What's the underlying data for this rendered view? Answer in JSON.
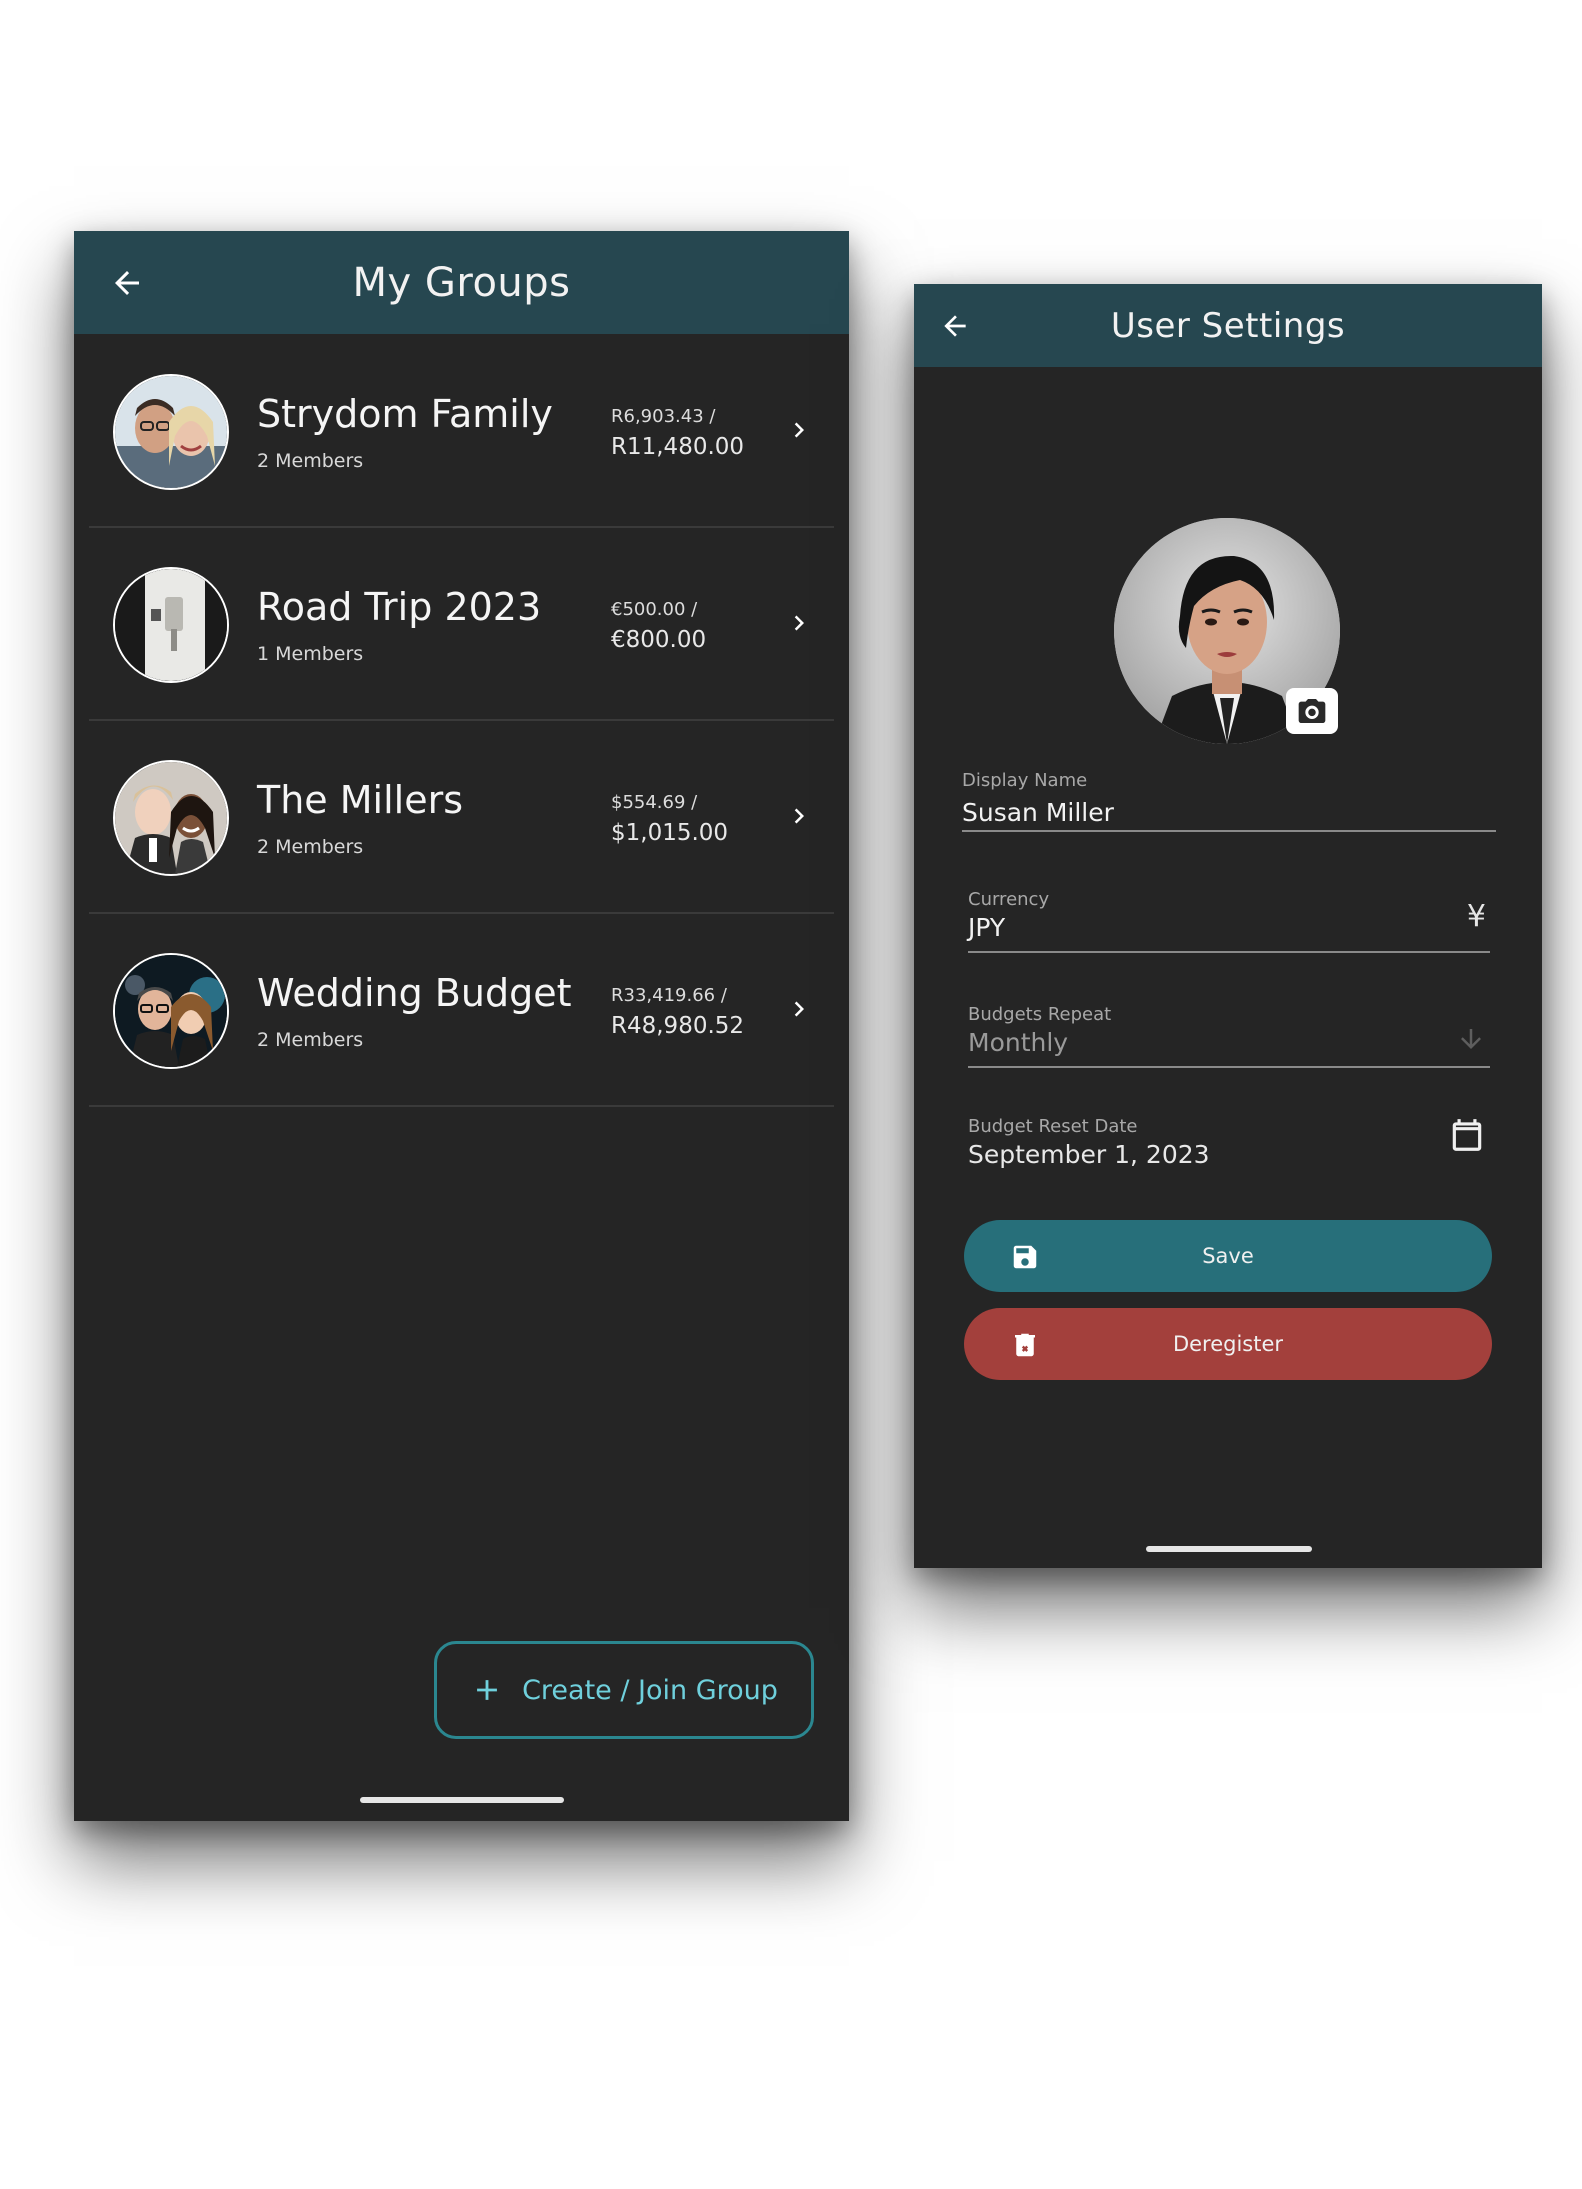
{
  "groups_screen": {
    "title": "My Groups",
    "groups": [
      {
        "name": "Strydom Family",
        "members": "2 Members",
        "spent": "R6,903.43 /",
        "budget": "R11,480.00"
      },
      {
        "name": "Road Trip 2023",
        "members": "1 Members",
        "spent": "€500.00 /",
        "budget": "€800.00"
      },
      {
        "name": "The Millers",
        "members": "2 Members",
        "spent": "$554.69 /",
        "budget": "$1,015.00"
      },
      {
        "name": "Wedding Budget",
        "members": "2 Members",
        "spent": "R33,419.66 /",
        "budget": "R48,980.52"
      }
    ],
    "create_button_label": "Create / Join Group"
  },
  "settings_screen": {
    "title": "User Settings",
    "fields": {
      "display_name": {
        "label": "Display Name",
        "value": "Susan Miller"
      },
      "currency": {
        "label": "Currency",
        "value": "JPY",
        "icon": "yen-icon"
      },
      "budgets_repeat": {
        "label": "Budgets Repeat",
        "value": "Monthly",
        "icon": "arrow-down-icon"
      },
      "reset_date": {
        "label": "Budget Reset Date",
        "value": "September 1, 2023",
        "icon": "calendar-icon"
      }
    },
    "save_label": "Save",
    "deregister_label": "Deregister"
  },
  "colors": {
    "appbar": "#264750",
    "background": "#252525",
    "accent": "#2b8790",
    "save": "#276f7a",
    "deregister": "#a3403c"
  }
}
